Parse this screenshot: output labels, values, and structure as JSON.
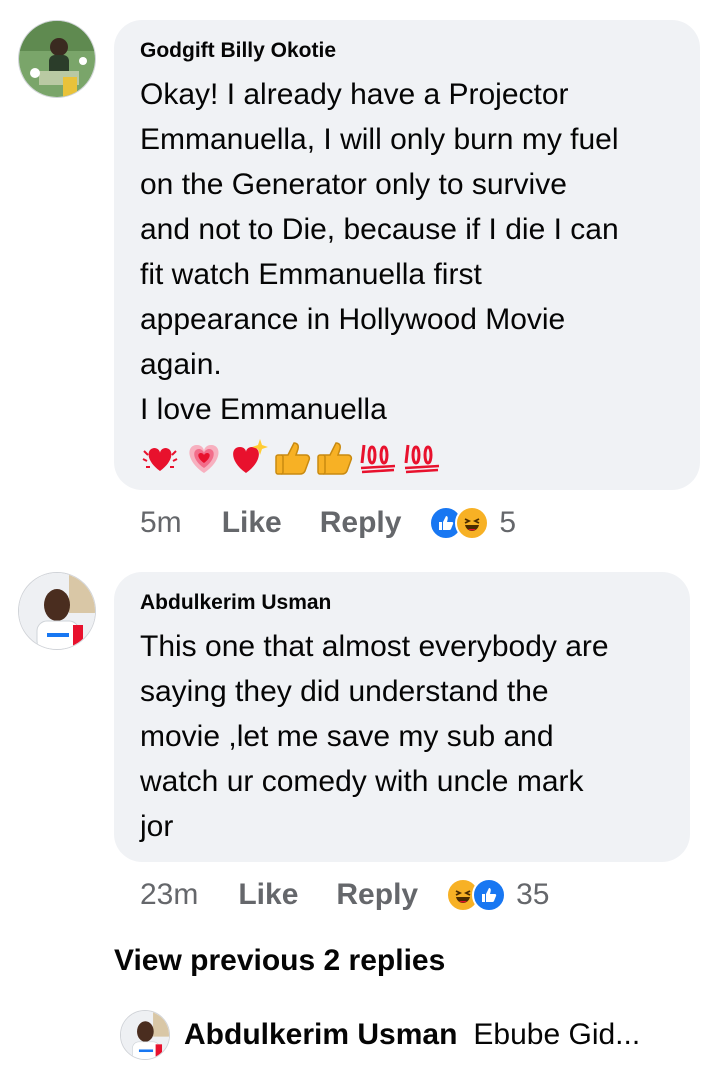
{
  "comments": [
    {
      "author": "Godgift Billy Okotie",
      "text": "Okay! I already have a Projector\nEmmanuella, I will only burn my fuel\non the Generator only to survive\nand not to Die, because if I die I can\nfit watch Emmanuella first\nappearance in Hollywood Movie\nagain.\nI love Emmanuella",
      "emojis": [
        "vibrating-heart",
        "growing-heart",
        "sparkling-heart",
        "thumbs-up",
        "thumbs-up",
        "hundred-points",
        "hundred-points"
      ],
      "time": "5m",
      "like_label": "Like",
      "reply_label": "Reply",
      "reactions": [
        "like",
        "haha"
      ],
      "reaction_count": "5"
    },
    {
      "author": "Abdulkerim Usman",
      "text": "This one that almost everybody are\nsaying they did understand the\nmovie ,let me save my sub and\nwatch ur comedy with uncle mark\njor",
      "time": "23m",
      "like_label": "Like",
      "reply_label": "Reply",
      "reactions": [
        "haha",
        "like"
      ],
      "reaction_count": "35"
    }
  ],
  "view_previous_replies": "View previous 2 replies",
  "reply_preview": {
    "author": "Abdulkerim Usman",
    "snippet": "Ebube Gid..."
  },
  "colors": {
    "bubble": "#f0f2f5",
    "meta_text": "#65676b",
    "like_blue": "#1877f2",
    "haha_yellow": "#f7b125"
  }
}
